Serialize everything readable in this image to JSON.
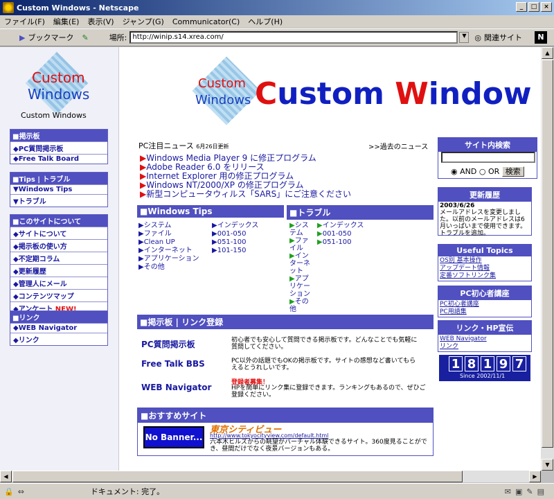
{
  "window": {
    "title": "Custom Windows - Netscape"
  },
  "menu": [
    "ファイル(F)",
    "編集(E)",
    "表示(V)",
    "ジャンプ(G)",
    "Communicator(C)",
    "ヘルプ(H)"
  ],
  "toolbar": {
    "bookmark": "ブックマーク",
    "location_label": "場所:",
    "url": "http://winip.s14.xrea.com/",
    "related": "関連サイト"
  },
  "status": {
    "text": "ドキュメント: 完了。"
  },
  "left": {
    "logo_line1": "Custom",
    "logo_line2": "Windows",
    "caption": "Custom Windows",
    "bbs": {
      "header": "■掲示板",
      "items": [
        "◆PC質問掲示板",
        "◆Free Talk Board"
      ]
    },
    "tips": {
      "header": "■Tips | トラブル",
      "items": [
        "▼Windows Tips",
        "▼トラブル"
      ]
    },
    "about": {
      "header": "■このサイトについて",
      "items": [
        "◆サイトについて",
        "◆掲示板の使い方",
        "◆不定期コラム",
        "◆更新履歴",
        "◆管理人にメール",
        "◆コンテンツマップ",
        "◆アンケート"
      ],
      "new_badge": "NEW!"
    },
    "links": {
      "header": "■リンク",
      "items": [
        "◆WEB Navigator",
        "◆リンク"
      ]
    }
  },
  "banner": {
    "logo_line1": "Custom",
    "logo_line2": "Windows",
    "big_c": "C",
    "big_rest1": "ustom ",
    "big_w": "W",
    "big_rest2": "indow"
  },
  "news": {
    "title": "PC注目ニュース",
    "date": "6月26日更新",
    "past": ">>過去のニュース",
    "items": [
      "Windows Media Player 9 に修正プログラム",
      "Adobe Reader 6.0 をリリース",
      "Internet Explorer 用の修正プログラム",
      "Windows NT/2000/XP の修正プログラム",
      "新型コンピュータウィルス「SARS」にご注意ください"
    ]
  },
  "wtips": {
    "header": "■Windows Tips",
    "col1": [
      "システム",
      "ファイル",
      "Clean UP",
      "インターネット",
      "アプリケーション",
      "その他"
    ],
    "col2": [
      "インデックス",
      "001-050",
      "051-100",
      "101-150"
    ]
  },
  "trouble": {
    "header": "■トラブル",
    "col1": [
      "システム",
      "ファイル",
      "インターネット",
      "アプリケーション",
      "その他"
    ],
    "col2": [
      "インデックス",
      "001-050",
      "051-100"
    ]
  },
  "bbslink": {
    "header": "■掲示板 | リンク登録",
    "rows": [
      {
        "name": "PC質問掲示板",
        "desc": "初心者でも安心して質問できる掲示板です。どんなことでも気軽に質問してください。"
      },
      {
        "name": "Free Talk BBS",
        "desc": "PC以外の話題でもOKの掲示板です。サイトの感想など書いてもらえるとうれしいです。"
      },
      {
        "name": "WEB Navigator",
        "badge": "登録者募集！",
        "desc": "HPを簡単にリンク集に登録できます。ランキングもあるので、ぜひご登録ください。"
      }
    ]
  },
  "recommend": {
    "header": "■おすすめサイト",
    "button": "No Banner...",
    "site": "東京シティビュー",
    "url": "http://www.tokyocityview.com/default.html",
    "desc": "六本木ヒルズからの眺望がバーチャル体験できるサイト。360度見ることができ、昼間だけでなく夜景バージョンもある。"
  },
  "search": {
    "header": "サイト内検索",
    "and": "AND",
    "or": "OR",
    "button": "検索"
  },
  "history": {
    "header": "更新履歴",
    "date": "2003/6/26",
    "text": "メールアドレスを変更しました。以前のメールアドレスは6月いっぱいまで使用できます。トラブルを追加。"
  },
  "useful": {
    "header": "Useful Topics",
    "items": [
      "OS別 基本操作",
      "アップデート情報",
      "定番ソフトリンク集"
    ]
  },
  "beginner": {
    "header": "PC初心者講座",
    "items": [
      "PC初心者講座",
      "PC用語集"
    ]
  },
  "linkhp": {
    "header": "リンク・HP宣伝",
    "items": [
      "WEB Navigator",
      "リンク"
    ]
  },
  "counter": {
    "digits": [
      "1",
      "8",
      "1",
      "9",
      "7"
    ],
    "since": "Since 2002/11/1"
  }
}
